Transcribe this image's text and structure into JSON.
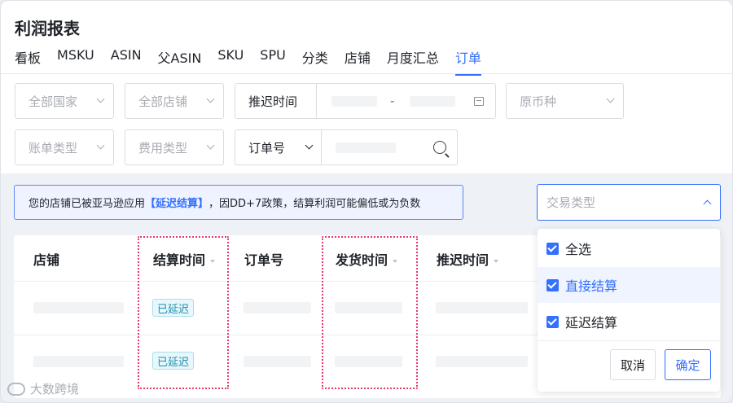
{
  "title": "利润报表",
  "tabs": [
    {
      "label": "看板"
    },
    {
      "label": "MSKU"
    },
    {
      "label": "ASIN"
    },
    {
      "label": "父ASIN"
    },
    {
      "label": "SKU"
    },
    {
      "label": "SPU"
    },
    {
      "label": "分类"
    },
    {
      "label": "店铺"
    },
    {
      "label": "月度汇总"
    },
    {
      "label": "订单",
      "active": true
    }
  ],
  "filters": {
    "country_placeholder": "全部国家",
    "shop_placeholder": "全部店铺",
    "delay_time_label": "推迟时间",
    "date_separator": "-",
    "currency_placeholder": "原币种",
    "bill_type_placeholder": "账单类型",
    "fee_type_placeholder": "费用类型",
    "order_no_label": "订单号"
  },
  "notice": {
    "prefix": "您的店铺已被亚马逊应用",
    "highlight": "【延迟结算】",
    "suffix": "，因DD+7政策，结算利润可能偏低或为负数"
  },
  "transaction_type": {
    "placeholder": "交易类型",
    "options": [
      {
        "label": "全选",
        "checked": true
      },
      {
        "label": "直接结算",
        "checked": true,
        "highlighted": true
      },
      {
        "label": "延迟结算",
        "checked": true
      }
    ],
    "cancel_label": "取消",
    "confirm_label": "确定"
  },
  "table": {
    "headers": [
      "店铺",
      "结算时间",
      "订单号",
      "发货时间",
      "推迟时间"
    ],
    "rows": [
      {
        "settle_status": "已延迟"
      },
      {
        "settle_status": "已延迟"
      }
    ]
  },
  "watermark": "大数跨境",
  "colors": {
    "accent": "#3370ff",
    "highlight_border": "#e8386d",
    "badge_text": "#1c8fad"
  }
}
